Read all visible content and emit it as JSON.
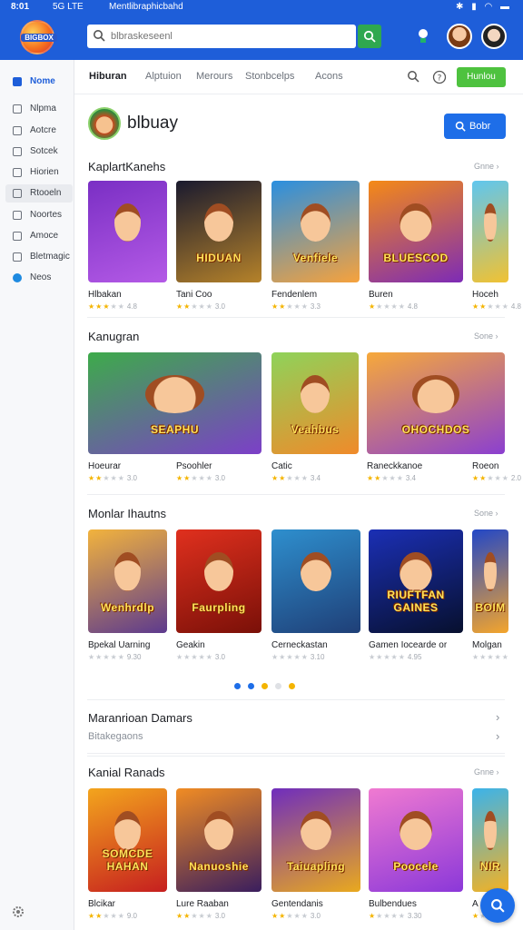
{
  "status_bar": {
    "time": "8:01",
    "network": "5G LTE",
    "app_name": "Mentlibraphicbahd"
  },
  "header": {
    "logo_text": "BIGBOX",
    "search": {
      "value": "",
      "placeholder": "blbraskeseenl"
    }
  },
  "sidebar": {
    "items": [
      {
        "label": "Nome",
        "icon": "home-icon"
      },
      {
        "label": "Nlpma",
        "icon": "document-icon"
      },
      {
        "label": "Aotcre",
        "icon": "list-icon"
      },
      {
        "label": "Sotcek",
        "icon": "grid-icon"
      },
      {
        "label": "Hiorien",
        "icon": "image-icon"
      },
      {
        "label": "Rtooeln",
        "icon": "folder-icon"
      },
      {
        "label": "Noortes",
        "icon": "mail-icon"
      },
      {
        "label": "Amoce",
        "icon": "note-icon"
      },
      {
        "label": "Bletmagic",
        "icon": "book-icon"
      },
      {
        "label": "Neos",
        "icon": "globe-icon"
      }
    ]
  },
  "nav": {
    "tabs": [
      "Hiburan",
      "Alptuion",
      "Merours",
      "Stonbcelps",
      "Acons"
    ],
    "button_label": "Hunlou"
  },
  "library": {
    "title": "blbuay",
    "button_label": "Bobr"
  },
  "sections": [
    {
      "title": "KaplartKanehs",
      "more": "Gnne",
      "cards": [
        {
          "name": "Hlbakan",
          "caption": "",
          "stars": "★★★",
          "gray": "★★",
          "num": "4.8",
          "colors": [
            "#7a2fc4",
            "#b45ae6"
          ]
        },
        {
          "name": "Tani Coo",
          "caption": "HIDUAN",
          "stars": "★★",
          "gray": "★★★",
          "num": "3.0",
          "colors": [
            "#1a1a2e",
            "#b5822a"
          ]
        },
        {
          "name": "Fendenlem",
          "caption": "Venfiele",
          "stars": "★★",
          "gray": "★★★",
          "num": "3.3",
          "colors": [
            "#2a8fe0",
            "#f7a23c"
          ]
        },
        {
          "name": "Buren",
          "caption": "BLUESCOD",
          "stars": "★",
          "gray": "★★★★",
          "num": "4.8",
          "colors": [
            "#f58a16",
            "#7d2bb6"
          ]
        },
        {
          "name": "Hoceh",
          "caption": "",
          "stars": "★★",
          "gray": "★★★",
          "num": "4.8",
          "colors": [
            "#5fc6ef",
            "#f1c232"
          ]
        }
      ]
    },
    {
      "title": "Kanugran",
      "more": "Sone",
      "cards": [
        {
          "name": "Hoeurar",
          "caption": "SEAPHU",
          "stars": "★★",
          "gray": "★★★",
          "num": "3.0",
          "colors": [
            "#3dab4a",
            "#7c3fc8"
          ]
        },
        {
          "name": "Psoohler",
          "caption": "",
          "stars": "★★",
          "gray": "★★★",
          "num": "3.0",
          "colors": [
            "#3dab4a",
            "#7c3fc8"
          ]
        },
        {
          "name": "Catic",
          "caption": "Veahbus",
          "stars": "★★",
          "gray": "★★★",
          "num": "3.4",
          "colors": [
            "#8ed35a",
            "#f08a2a"
          ]
        },
        {
          "name": "Raneckkanoe",
          "caption": "OHOCHDOS",
          "stars": "★★",
          "gray": "★★★",
          "num": "3.4",
          "colors": [
            "#f7a93a",
            "#8b3fd0"
          ]
        },
        {
          "name": "Roeon",
          "caption": "",
          "stars": "★★",
          "gray": "★★★",
          "num": "2.0",
          "colors": [
            "#f7a93a",
            "#8b3fd0"
          ]
        }
      ]
    },
    {
      "title": "Monlar Ihautns",
      "more": "Sone",
      "cards": [
        {
          "name": "Bpekal Uarning",
          "caption": "Wenhrdlp",
          "stars": "",
          "gray": "★★★★★",
          "num": "9.30",
          "colors": [
            "#f2b33d",
            "#5d3a8e"
          ]
        },
        {
          "name": "Geakin",
          "caption": "Faurpling",
          "stars": "",
          "gray": "★★★★★",
          "num": "3.0",
          "colors": [
            "#e0301e",
            "#7a1008"
          ]
        },
        {
          "name": "Cerneckastan",
          "caption": "",
          "stars": "",
          "gray": "★★★★★",
          "num": "3.10",
          "colors": [
            "#2e8fce",
            "#1f3f77"
          ]
        },
        {
          "name": "Gamen Iocearde or",
          "caption": "RIUFTFAN GAINES",
          "stars": "",
          "gray": "★★★★★",
          "num": "4.95",
          "colors": [
            "#1b2fb5",
            "#07102e"
          ]
        },
        {
          "name": "Molgan",
          "caption": "BOIM",
          "stars": "",
          "gray": "★★★★★",
          "num": "",
          "colors": [
            "#2247c7",
            "#f4a52c"
          ]
        }
      ]
    },
    {
      "title": "Kanial Ranads",
      "more": "Gnne",
      "cards": [
        {
          "name": "Blcikar",
          "caption": "SOMCDE HAHAN",
          "stars": "★★",
          "gray": "★★★",
          "num": "9.0",
          "colors": [
            "#f3a51d",
            "#c61f1f"
          ]
        },
        {
          "name": "Lure Raaban",
          "caption": "Nanuoshie",
          "stars": "★★",
          "gray": "★★★",
          "num": "3.0",
          "colors": [
            "#f18c23",
            "#3a1e5e"
          ]
        },
        {
          "name": "Gentendanis",
          "caption": "Taiuapling",
          "stars": "★★",
          "gray": "★★★",
          "num": "3.0",
          "colors": [
            "#6f2dbd",
            "#e9a91e"
          ]
        },
        {
          "name": "Bulbendues",
          "caption": "Poocele",
          "stars": "★",
          "gray": "★★★★",
          "num": "3.30",
          "colors": [
            "#f07ad1",
            "#8b38d9"
          ]
        },
        {
          "name": "A",
          "caption": "NIR",
          "stars": "★",
          "gray": "★★★★",
          "num": "",
          "colors": [
            "#3bb3ea",
            "#f3b224"
          ]
        }
      ]
    }
  ],
  "pager_colors": [
    "#1e6ee8",
    "#1e6ee8",
    "#f4b400",
    "#dfe1e5",
    "#f4b400"
  ],
  "promo": {
    "title": "Maranrioan Damars",
    "subtitle": "Bitakegaons"
  },
  "colors": {
    "brand": "#1e5ed9",
    "accent_green": "#4ec23f",
    "star": "#f4b400"
  }
}
